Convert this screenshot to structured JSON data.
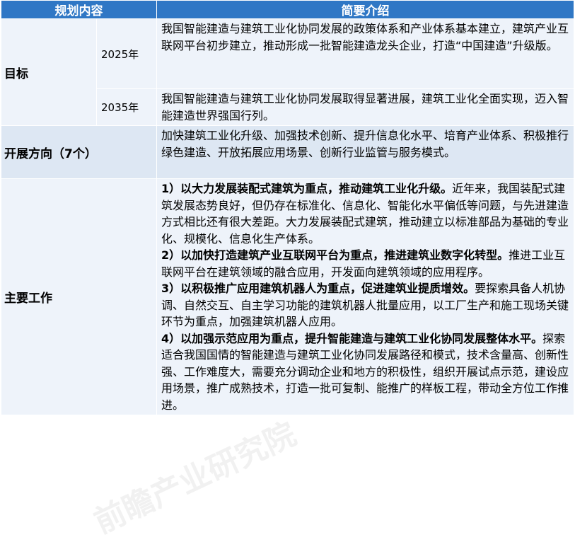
{
  "header": {
    "col1": "规划内容",
    "col2": "简要介绍"
  },
  "goal": {
    "label": "目标",
    "rows": [
      {
        "year": "2025年",
        "text": "我国智能建造与建筑工业化协同发展的政策体系和产业体系基本建立，建筑产业互联网平台初步建立，推动形成一批智能建造龙头企业，打造“中国建造”升级版。"
      },
      {
        "year": "2035年",
        "text": "我国智能建造与建筑工业化协同发展取得显著进展，建筑工业化全面实现，迈入智能建造世界强国行列。"
      }
    ]
  },
  "direction": {
    "label": "开展方向（7个）",
    "text": "加快建筑工业化升级、加强技术创新、提升信息化水平、培育产业体系、积极推行绿色建造、开放拓展应用场景、创新行业监管与服务模式。"
  },
  "work": {
    "label": "主要工作",
    "items": [
      {
        "title": "1）以大力发展装配式建筑为重点，推动建筑工业化升级。",
        "body": "近年来，我国装配式建筑发展态势良好，但仍存在标准化、信息化、智能化水平偏低等问题，与先进建造方式相比还有很大差距。大力发展装配式建筑，推动建立以标准部品为基础的专业化、规模化、信息化生产体系。"
      },
      {
        "title": "2）以加快打造建筑产业互联网平台为重点，推进建筑业数字化转型。",
        "body": "推进工业互联网平台在建筑领域的融合应用，开发面向建筑领域的应用程序。"
      },
      {
        "title": "3）以积极推广应用建筑机器人为重点，促进建筑业提质增效。",
        "body": "要探索具备人机协调、自然交互、自主学习功能的建筑机器人批量应用，以工厂生产和施工现场关键环节为重点，加强建筑机器人应用。"
      },
      {
        "title": "4）以加强示范应用为重点，提升智能建造与建筑工业化协同发展整体水平。",
        "body": "探索适合我国国情的智能建造与建筑工业化协同发展路径和模式，技术含量高、创新性强、工作难度大，需要充分调动企业和地方的积极性，组织开展试点示范，建设应用场景，推广成熟技术，打造一批可复制、能推广的样板工程，带动全方位工作推进。"
      }
    ]
  },
  "watermark": {
    "text": "前瞻产业研究院"
  }
}
